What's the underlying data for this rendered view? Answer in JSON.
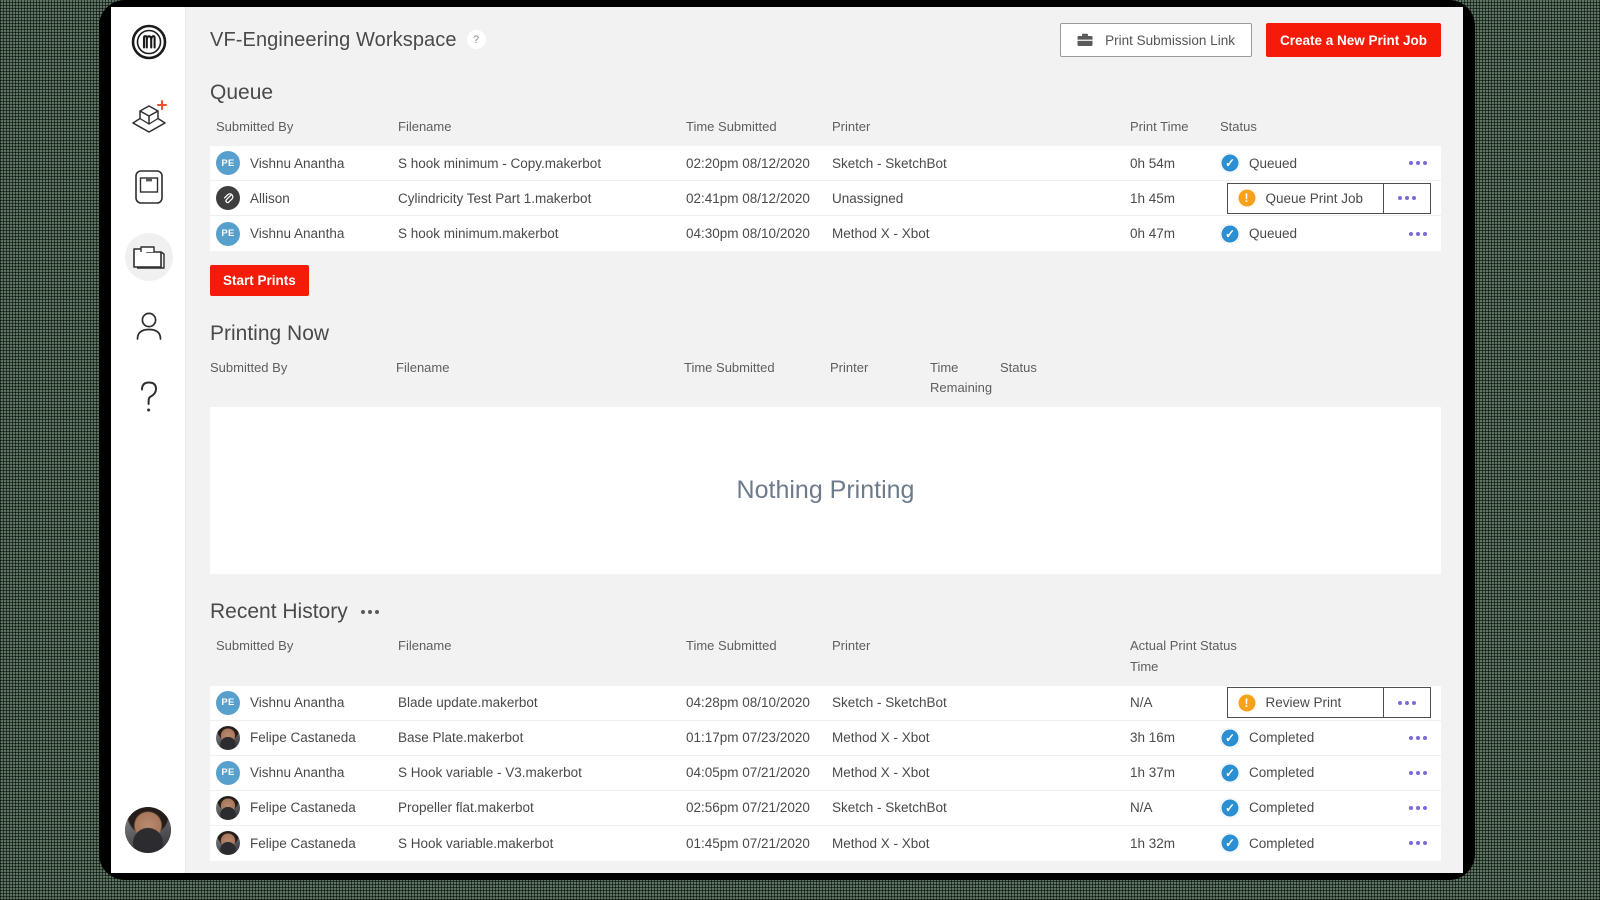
{
  "window": {
    "backdrop_color": "#5c7560",
    "frame_color": "#000000",
    "app_bg": "#f2f2f2"
  },
  "sidebar": {
    "logo_name": "makerbot-logo",
    "items": [
      {
        "name": "add-print-job",
        "icon": "cube-plus-icon",
        "active": false
      },
      {
        "name": "printers",
        "icon": "printer-icon",
        "active": false
      },
      {
        "name": "print-queue",
        "icon": "folder-icon",
        "active": true
      },
      {
        "name": "account",
        "icon": "person-icon",
        "active": false
      },
      {
        "name": "help",
        "icon": "question-mark-icon",
        "active": false
      }
    ],
    "user_avatar_name": "user-avatar"
  },
  "header": {
    "title": "VF-Engineering Workspace",
    "help_badge": "?",
    "print_submission_link_label": "Print Submission Link",
    "create_job_label": "Create a New Print Job",
    "accent_red": "#f61b09"
  },
  "queue": {
    "title": "Queue",
    "columns": [
      "Submitted By",
      "Filename",
      "Time Submitted",
      "Printer",
      "Print Time",
      "Status"
    ],
    "rows": [
      {
        "avatar_type": "initials",
        "avatar_text": "PE",
        "submitted_by": "Vishnu Anantha",
        "filename": "S hook minimum - Copy.makerbot",
        "time_submitted": "02:20pm 08/12/2020",
        "printer": "Sketch - SketchBot",
        "print_time": "0h 54m",
        "status": "Queued",
        "status_icon": "check-circle-icon",
        "status_color": "#2b8fd1",
        "selected": false
      },
      {
        "avatar_type": "clip",
        "avatar_text": "",
        "submitted_by": "Allison",
        "filename": "Cylindricity Test Part 1.makerbot",
        "time_submitted": "02:41pm 08/12/2020",
        "printer": "Unassigned",
        "print_time": "1h 45m",
        "status": "Queue Print Job",
        "status_icon": "warning-circle-icon",
        "status_color": "#f6a21d",
        "selected": true
      },
      {
        "avatar_type": "initials",
        "avatar_text": "PE",
        "submitted_by": "Vishnu Anantha",
        "filename": "S hook minimum.makerbot",
        "time_submitted": "04:30pm 08/10/2020",
        "printer": "Method X - Xbot",
        "print_time": "0h 47m",
        "status": "Queued",
        "status_icon": "check-circle-icon",
        "status_color": "#2b8fd1",
        "selected": false
      }
    ],
    "start_prints_label": "Start Prints"
  },
  "printing_now": {
    "title": "Printing Now",
    "columns": [
      "Submitted By",
      "Filename",
      "Time Submitted",
      "Printer",
      "Time Remaining",
      "Status"
    ],
    "empty_message": "Nothing Printing",
    "rows": []
  },
  "recent_history": {
    "title": "Recent History",
    "menu_icon": "more-options-icon",
    "columns": [
      "Submitted By",
      "Filename",
      "Time Submitted",
      "Printer",
      "Actual Print Time",
      "Status"
    ],
    "rows": [
      {
        "avatar_type": "initials",
        "avatar_text": "PE",
        "submitted_by": "Vishnu Anantha",
        "filename": "Blade update.makerbot",
        "time_submitted": "04:28pm 08/10/2020",
        "printer": "Sketch - SketchBot",
        "actual_print_time": "N/A",
        "status": "Review Print",
        "status_icon": "warning-circle-icon",
        "status_color": "#f6a21d",
        "selected": true
      },
      {
        "avatar_type": "photo",
        "avatar_text": "",
        "submitted_by": "Felipe Castaneda",
        "filename": "Base Plate.makerbot",
        "time_submitted": "01:17pm 07/23/2020",
        "printer": "Method X - Xbot",
        "actual_print_time": "3h 16m",
        "status": "Completed",
        "status_icon": "check-circle-icon",
        "status_color": "#2b8fd1",
        "selected": false
      },
      {
        "avatar_type": "initials",
        "avatar_text": "PE",
        "submitted_by": "Vishnu Anantha",
        "filename": "S Hook variable - V3.makerbot",
        "time_submitted": "04:05pm 07/21/2020",
        "printer": "Method X - Xbot",
        "actual_print_time": "1h 37m",
        "status": "Completed",
        "status_icon": "check-circle-icon",
        "status_color": "#2b8fd1",
        "selected": false
      },
      {
        "avatar_type": "photo",
        "avatar_text": "",
        "submitted_by": "Felipe Castaneda",
        "filename": "Propeller flat.makerbot",
        "time_submitted": "02:56pm 07/21/2020",
        "printer": "Sketch - SketchBot",
        "actual_print_time": "N/A",
        "status": "Completed",
        "status_icon": "check-circle-icon",
        "status_color": "#2b8fd1",
        "selected": false
      },
      {
        "avatar_type": "photo",
        "avatar_text": "",
        "submitted_by": "Felipe Castaneda",
        "filename": "S Hook variable.makerbot",
        "time_submitted": "01:45pm 07/21/2020",
        "printer": "Method X - Xbot",
        "actual_print_time": "1h 32m",
        "status": "Completed",
        "status_icon": "check-circle-icon",
        "status_color": "#2b8fd1",
        "selected": false
      }
    ]
  },
  "glyphs": {
    "check": "✓",
    "warning": "!",
    "row_menu": "more-options-icon"
  }
}
